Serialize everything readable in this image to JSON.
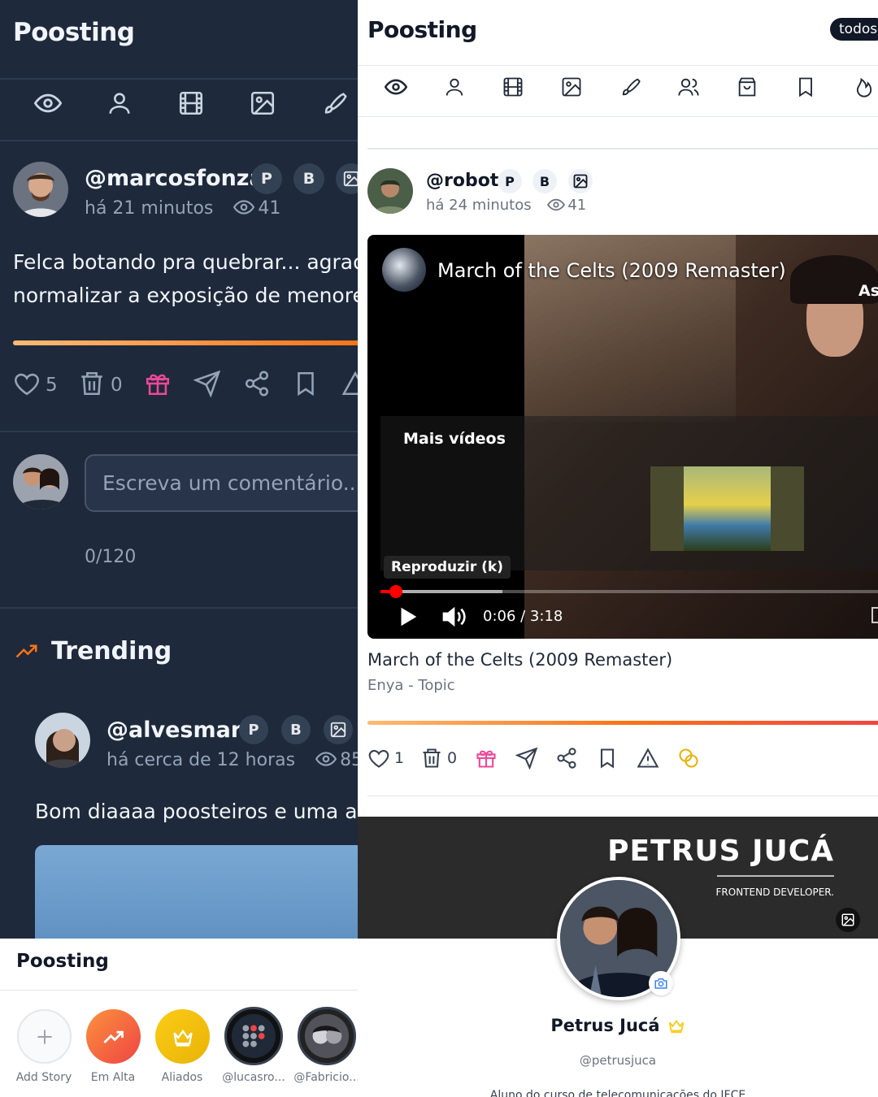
{
  "left_panel": {
    "title": "Poosting",
    "post": {
      "username": "@marcosfonzar",
      "badges": [
        "P",
        "B"
      ],
      "time": "há 21 minutos",
      "views": "41",
      "text_line1": "Felca botando pra quebrar... agradan",
      "text_line2": "normalizar a exposição de menores",
      "likes": "5",
      "deletes": "0"
    },
    "comment": {
      "placeholder": "Escreva um comentário...",
      "counter": "0/120"
    },
    "trending": {
      "heading": "Trending",
      "username": "@alvesmara",
      "badges": [
        "P",
        "B"
      ],
      "time": "há cerca de 12 horas",
      "views": "85",
      "text": "Bom diaaaa poosteiros e uma abe"
    }
  },
  "right_panel": {
    "title": "Poosting",
    "filter_pill": "todos",
    "post": {
      "username": "@robot",
      "badges": [
        "P",
        "B"
      ],
      "time": "há 24 minutos",
      "views": "41",
      "video": {
        "overlay_title": "March of the Celts (2009 Remaster)",
        "overlay_right_text": "As",
        "more_videos": "Mais vídeos",
        "play_tooltip": "Reproduzir (k)",
        "time_display": "0:06 / 3:18",
        "progress": 0.03
      },
      "video_title": "March of the Celts (2009 Remaster)",
      "channel": "Enya - Topic",
      "likes": "1",
      "deletes": "0"
    }
  },
  "stories_panel": {
    "title": "Poosting",
    "items": [
      {
        "label": "Add Story"
      },
      {
        "label": "Em Alta"
      },
      {
        "label": "Aliados"
      },
      {
        "label": "@lucasro..."
      },
      {
        "label": "@Fabricio..."
      }
    ]
  },
  "profile": {
    "banner_name": "PETRUS JUCÁ",
    "banner_role": "FRONTEND DEVELOPER.",
    "display_name": "Petrus Jucá",
    "handle": "@petrusjuca",
    "bio": "Aluno do curso de telecomunicações do IFCE"
  },
  "colors": {
    "dark_bg": "#1e293b",
    "accent_orange": "#f97316",
    "gift_pink": "#ec4899",
    "crown_yellow": "#facc15"
  }
}
